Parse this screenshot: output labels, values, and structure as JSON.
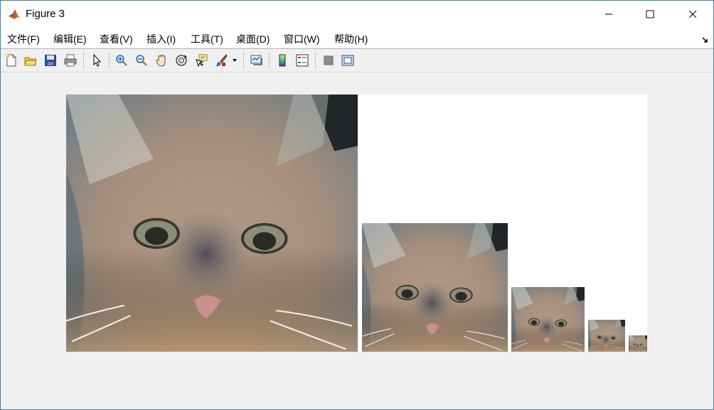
{
  "window": {
    "title": "Figure 3",
    "controls": {
      "minimize": "minimize",
      "maximize": "maximize",
      "close": "close"
    }
  },
  "menubar": {
    "items": [
      {
        "label": "文件(F)"
      },
      {
        "label": "编辑(E)"
      },
      {
        "label": "查看(V)"
      },
      {
        "label": "插入(I)"
      },
      {
        "label": "工具(T)"
      },
      {
        "label": "桌面(D)"
      },
      {
        "label": "窗口(W)"
      },
      {
        "label": "帮助(H)"
      }
    ]
  },
  "toolbar": {
    "buttons": [
      "new-figure-icon",
      "open-file-icon",
      "save-figure-icon",
      "print-figure-icon",
      "edit-plot-arrow-icon",
      "zoom-in-icon",
      "zoom-out-icon",
      "pan-hand-icon",
      "rotate-3d-icon",
      "data-cursor-icon",
      "brush-icon",
      "brush-dropdown-icon",
      "link-plot-icon",
      "insert-colorbar-icon",
      "insert-legend-icon",
      "hide-plot-tools-icon",
      "show-plot-tools-icon"
    ]
  },
  "figure": {
    "content": "image pyramid of a cat face, 5 levels decreasing in size",
    "background": "#ffffff",
    "levels": 5
  },
  "colors": {
    "window_border": "#3c7fb1",
    "chrome": "#f0f0f0",
    "canvas": "#ffffff"
  }
}
